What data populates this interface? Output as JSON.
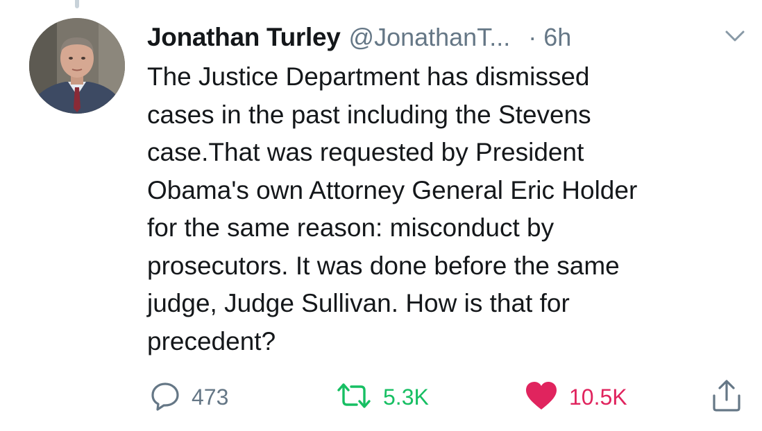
{
  "tweet": {
    "author": {
      "display_name": "Jonathan Turley",
      "handle": "@JonathanT...",
      "avatar": "avatar"
    },
    "separator": "·",
    "time": "6h",
    "text": "The Justice Department has dismissed\ncases in the past including the Stevens\ncase.That was requested by President\nObama's own Attorney General Eric Holder\nfor the same reason: misconduct by\nprosecutors. It was done before the same\njudge, Judge Sullivan. How is that for\nprecedent?",
    "actions": {
      "reply": {
        "icon": "reply-icon",
        "count": "473"
      },
      "retweet": {
        "icon": "retweet-icon",
        "count": "5.3K",
        "color": "#17bf63"
      },
      "like": {
        "icon": "heart-icon",
        "count": "10.5K",
        "color": "#e0245e"
      },
      "share": {
        "icon": "share-icon"
      }
    },
    "menu_icon": "chevron-down-icon"
  }
}
